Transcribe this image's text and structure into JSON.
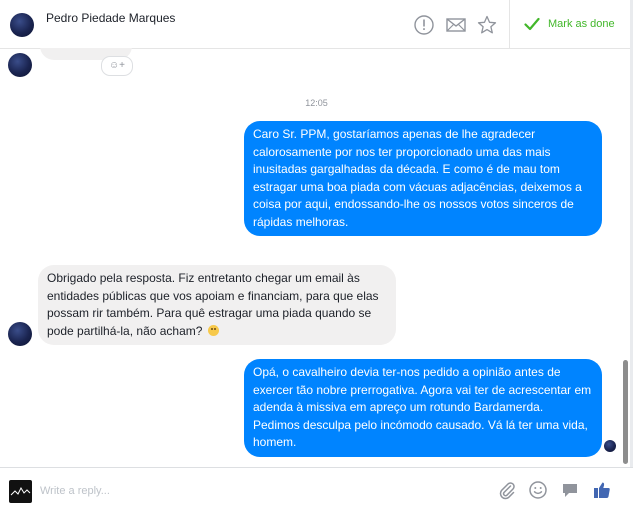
{
  "header": {
    "contact_name": "Pedro Piedade Marques",
    "mark_done_label": "Mark as done",
    "icons": [
      "alert-icon",
      "envelope-icon",
      "star-icon",
      "checkmark-icon"
    ]
  },
  "thread": {
    "reaction_label": "☺+",
    "timestamp": "12:05",
    "messages": [
      {
        "direction": "outgoing",
        "text": "Caro Sr. PPM, gostaríamos apenas de lhe agradecer calorosamente por nos ter proporcionado uma das mais inusitadas gargalhadas da década. E como é de mau tom estragar uma boa piada com vácuas adjacências, deixemos a coisa por aqui, endossando-lhe os nossos votos sinceros de rápidas melhoras."
      },
      {
        "direction": "incoming",
        "text": "Obrigado pela resposta. Fiz entretanto chegar um email às entidades públicas que vos apoiam e financiam, para que elas possam rir também. Para quê estragar uma piada quando se pode partilhá-la, não acham?",
        "emoji": "smile-emoji"
      },
      {
        "direction": "outgoing",
        "text": "Opá, o cavalheiro devia ter-nos pedido a opinião antes de exercer tão nobre prerrogativa. Agora vai ter de acrescentar em adenda à missiva em apreço um rotundo Bardamerda. Pedimos desculpa pelo incómodo causado. Vá lá ter uma vida, homem."
      }
    ]
  },
  "composer": {
    "placeholder": "Write a reply...",
    "icons": [
      "paperclip-icon",
      "emoji-icon",
      "sticker-icon",
      "thumbs-up-icon"
    ]
  },
  "colors": {
    "outgoing_bubble": "#0084ff",
    "incoming_bubble": "#f1f0f0",
    "mark_done_green": "#42b72a",
    "thumbs_up_blue": "#4267b2"
  }
}
